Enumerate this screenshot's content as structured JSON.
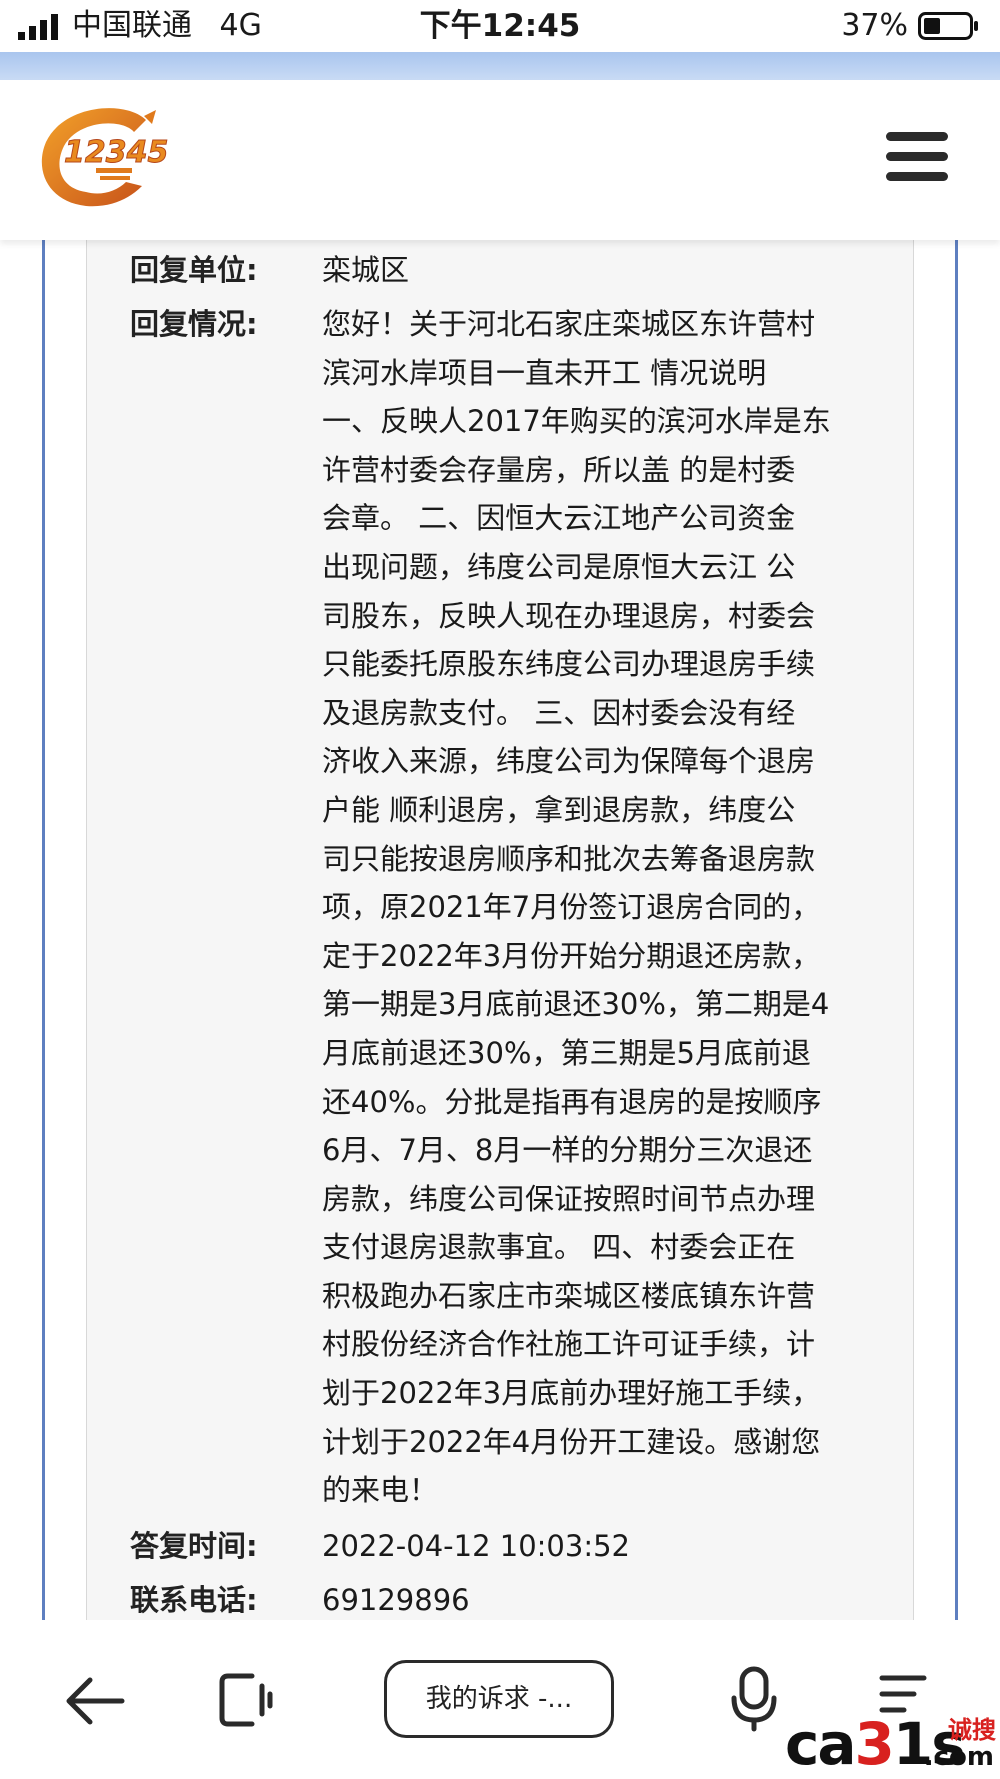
{
  "status_bar": {
    "carrier": "中国联通",
    "network": "4G",
    "time": "下午12:45",
    "battery": "37%"
  },
  "header": {
    "logo_text": "12345",
    "menu_icon": "hamburger-menu-icon"
  },
  "detail": {
    "reply_unit_label": "回复单位:",
    "reply_unit_value": "栾城区",
    "reply_status_label": "回复情况:",
    "reply_lines": [
      "您好！关于河北石家庄栾城区东许营村",
      "滨河水岸项目一直未开工 情况说明",
      "一、反映人2017年购买的滨河水岸是东",
      "许营村委会存量房，所以盖 的是村委",
      "会章。 二、因恒大云江地产公司资金",
      "出现问题，纬度公司是原恒大云江 公",
      "司股东，反映人现在办理退房，村委会",
      "只能委托原股东纬度公司办理退房手续",
      "及退房款支付。 三、因村委会没有经",
      "济收入来源，纬度公司为保障每个退房",
      "户能 顺利退房，拿到退房款，纬度公",
      "司只能按退房顺序和批次去筹备退房款",
      "项，原2021年7月份签订退房合同的，",
      "定于2022年3月份开始分期退还房款，",
      "第一期是3月底前退还30%，第二期是4",
      "月底前退还30%，第三期是5月底前退",
      "还40%。分批是指再有退房的是按顺序",
      "6月、7月、8月一样的分期分三次退还",
      "房款，纬度公司保证按照时间节点办理",
      "支付退房退款事宜。 四、村委会正在",
      "积极跑办石家庄市栾城区楼底镇东许营",
      "村股份经济合作社施工许可证手续，计",
      "划于2022年3月底前办理好施工手续，",
      "计划于2022年4月份开工建设。感谢您",
      "的来电！"
    ],
    "reply_time_label": "答复时间:",
    "reply_time_value": "2022-04-12 10:03:52",
    "phone_label": "联系电话:",
    "phone_value": "69129896"
  },
  "bottom_nav": {
    "complaint_label": "我的诉求 -...",
    "watermark_main": "ca",
    "watermark_red": "3",
    "watermark_tail": "1s",
    "watermark_cn": "诚搜",
    "watermark_com": ".com"
  },
  "colors": {
    "accent_blue": "#5e7fc0",
    "band_blue": "#b8cff0",
    "panel_bg": "#f6f6f6",
    "logo_orange": "#e07a1c",
    "watermark_red": "#d8211f"
  }
}
